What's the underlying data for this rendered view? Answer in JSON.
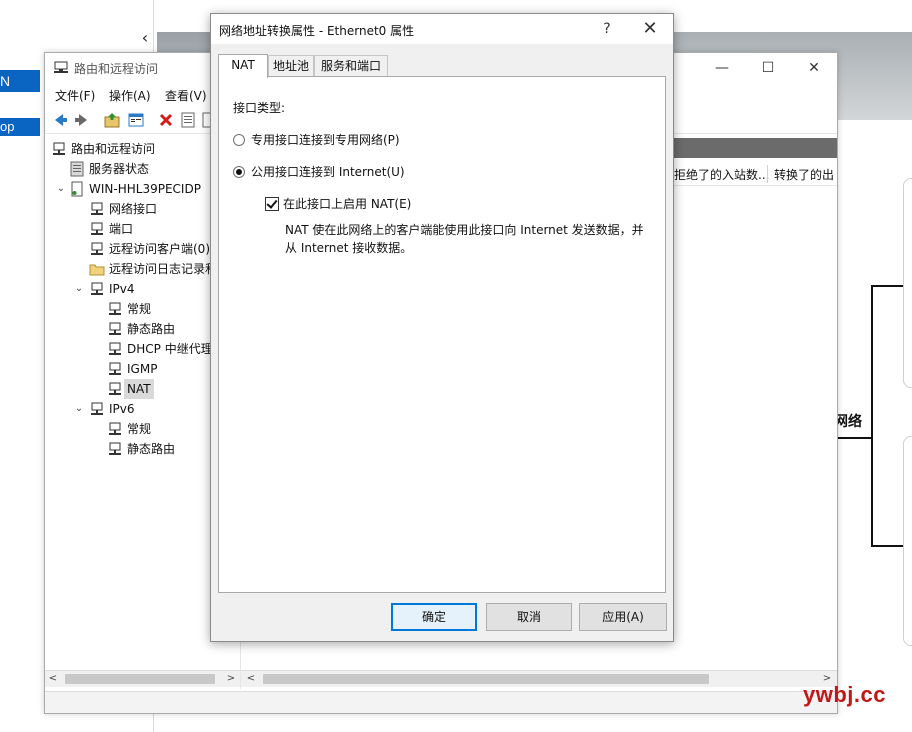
{
  "background": {
    "left_app": {
      "partial_label_1": "N",
      "partial_label_2": "op"
    },
    "right_diagram": {
      "partial_label": "网络"
    }
  },
  "rras_window": {
    "title": "路由和远程访问",
    "menu": [
      "文件(F)",
      "操作(A)",
      "查看(V)"
    ],
    "tree": [
      {
        "label": "路由和远程访问",
        "level": 0,
        "expanded": null,
        "icon": "rras-root-icon",
        "selected": false
      },
      {
        "label": "服务器状态",
        "level": 1,
        "expanded": null,
        "icon": "server-status-icon",
        "selected": false
      },
      {
        "label": "WIN-HHL39PECIDP",
        "level": 1,
        "expanded": true,
        "icon": "server-icon",
        "selected": false
      },
      {
        "label": "网络接口",
        "level": 2,
        "expanded": null,
        "icon": "network-node-icon",
        "selected": false
      },
      {
        "label": "端口",
        "level": 2,
        "expanded": null,
        "icon": "network-node-icon",
        "selected": false
      },
      {
        "label": "远程访问客户端(0)",
        "level": 2,
        "expanded": null,
        "icon": "network-node-icon",
        "selected": false
      },
      {
        "label": "远程访问日志记录和",
        "level": 2,
        "expanded": null,
        "icon": "folder-icon",
        "selected": false
      },
      {
        "label": "IPv4",
        "level": 2,
        "expanded": true,
        "icon": "network-node-icon",
        "selected": false
      },
      {
        "label": "常规",
        "level": 3,
        "expanded": null,
        "icon": "network-node-icon",
        "selected": false
      },
      {
        "label": "静态路由",
        "level": 3,
        "expanded": null,
        "icon": "network-node-icon",
        "selected": false
      },
      {
        "label": "DHCP 中继代理",
        "level": 3,
        "expanded": null,
        "icon": "network-node-icon",
        "selected": false
      },
      {
        "label": "IGMP",
        "level": 3,
        "expanded": null,
        "icon": "network-node-icon",
        "selected": false
      },
      {
        "label": "NAT",
        "level": 3,
        "expanded": null,
        "icon": "network-node-icon",
        "selected": true
      },
      {
        "label": "IPv6",
        "level": 2,
        "expanded": true,
        "icon": "network-node-icon",
        "selected": false
      },
      {
        "label": "常规",
        "level": 3,
        "expanded": null,
        "icon": "network-node-icon",
        "selected": false
      },
      {
        "label": "静态路由",
        "level": 3,
        "expanded": null,
        "icon": "network-node-icon",
        "selected": false
      }
    ],
    "columns": [
      "拒绝了的入站数...",
      "转换了的出"
    ]
  },
  "dialog": {
    "title": "网络地址转换属性 - Ethernet0 属性",
    "help_label": "?",
    "close_label": "✕",
    "tabs": [
      "NAT",
      "地址池",
      "服务和端口"
    ],
    "active_tab": "NAT",
    "section_label": "接口类型:",
    "radio_private": "专用接口连接到专用网络(P)",
    "radio_public": "公用接口连接到 Internet(U)",
    "radio_selected": "public",
    "checkbox_enable_nat": "在此接口上启用 NAT(E)",
    "checkbox_enable_nat_checked": true,
    "description": "NAT 使在此网络上的客户端能使用此接口向 Internet 发送数据，并从 Internet 接收数据。",
    "buttons": {
      "ok": "确定",
      "cancel": "取消",
      "apply": "应用(A)"
    }
  },
  "watermark": "ywbj.cc",
  "colors": {
    "accent": "#0078d7",
    "selection_blue": "#0a64c2",
    "dialog_bg": "#f0f0f0",
    "watermark": "#c41616"
  }
}
